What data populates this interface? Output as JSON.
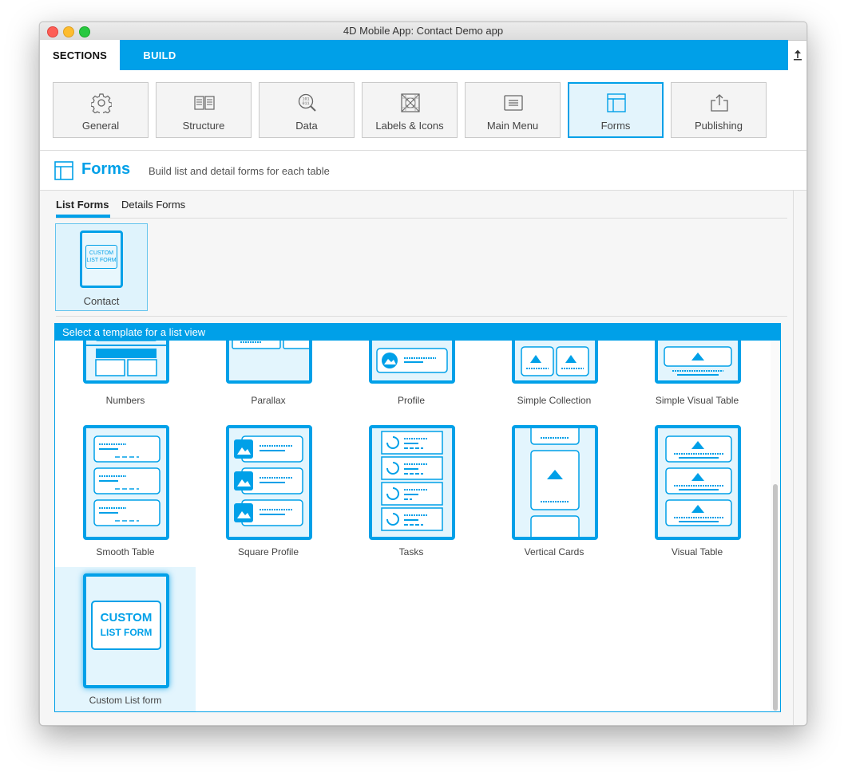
{
  "window": {
    "title": "4D Mobile App: Contact Demo app"
  },
  "topbar": {
    "sections_label": "SECTIONS",
    "build_label": "BUILD"
  },
  "sections": [
    {
      "label": "General",
      "icon": "gear-icon"
    },
    {
      "label": "Structure",
      "icon": "structure-icon"
    },
    {
      "label": "Data",
      "icon": "data-search-icon"
    },
    {
      "label": "Labels & Icons",
      "icon": "labels-icons-icon"
    },
    {
      "label": "Main Menu",
      "icon": "menu-icon"
    },
    {
      "label": "Forms",
      "icon": "forms-icon",
      "active": true
    },
    {
      "label": "Publishing",
      "icon": "publish-icon"
    }
  ],
  "forms_header": {
    "title": "Forms",
    "subtitle": "Build list and detail forms for each table"
  },
  "subtabs": {
    "list": "List Forms",
    "details": "Details Forms"
  },
  "tables": [
    {
      "name": "Contact",
      "thumb_line1": "CUSTOM",
      "thumb_line2": "LIST FORM"
    }
  ],
  "template_panel": {
    "header": "Select a template for a list view",
    "templates": [
      {
        "label": "Numbers"
      },
      {
        "label": "Parallax"
      },
      {
        "label": "Profile"
      },
      {
        "label": "Simple Collection"
      },
      {
        "label": "Simple Visual Table"
      },
      {
        "label": "Smooth Table"
      },
      {
        "label": "Square Profile"
      },
      {
        "label": "Tasks"
      },
      {
        "label": "Vertical Cards"
      },
      {
        "label": "Visual Table"
      },
      {
        "label": "Custom List form",
        "line1": "CUSTOM",
        "line2": "LIST FORM",
        "selected": true
      }
    ]
  },
  "colors": {
    "accent": "#00a0e8",
    "selected_bg": "#e3f5fd"
  }
}
